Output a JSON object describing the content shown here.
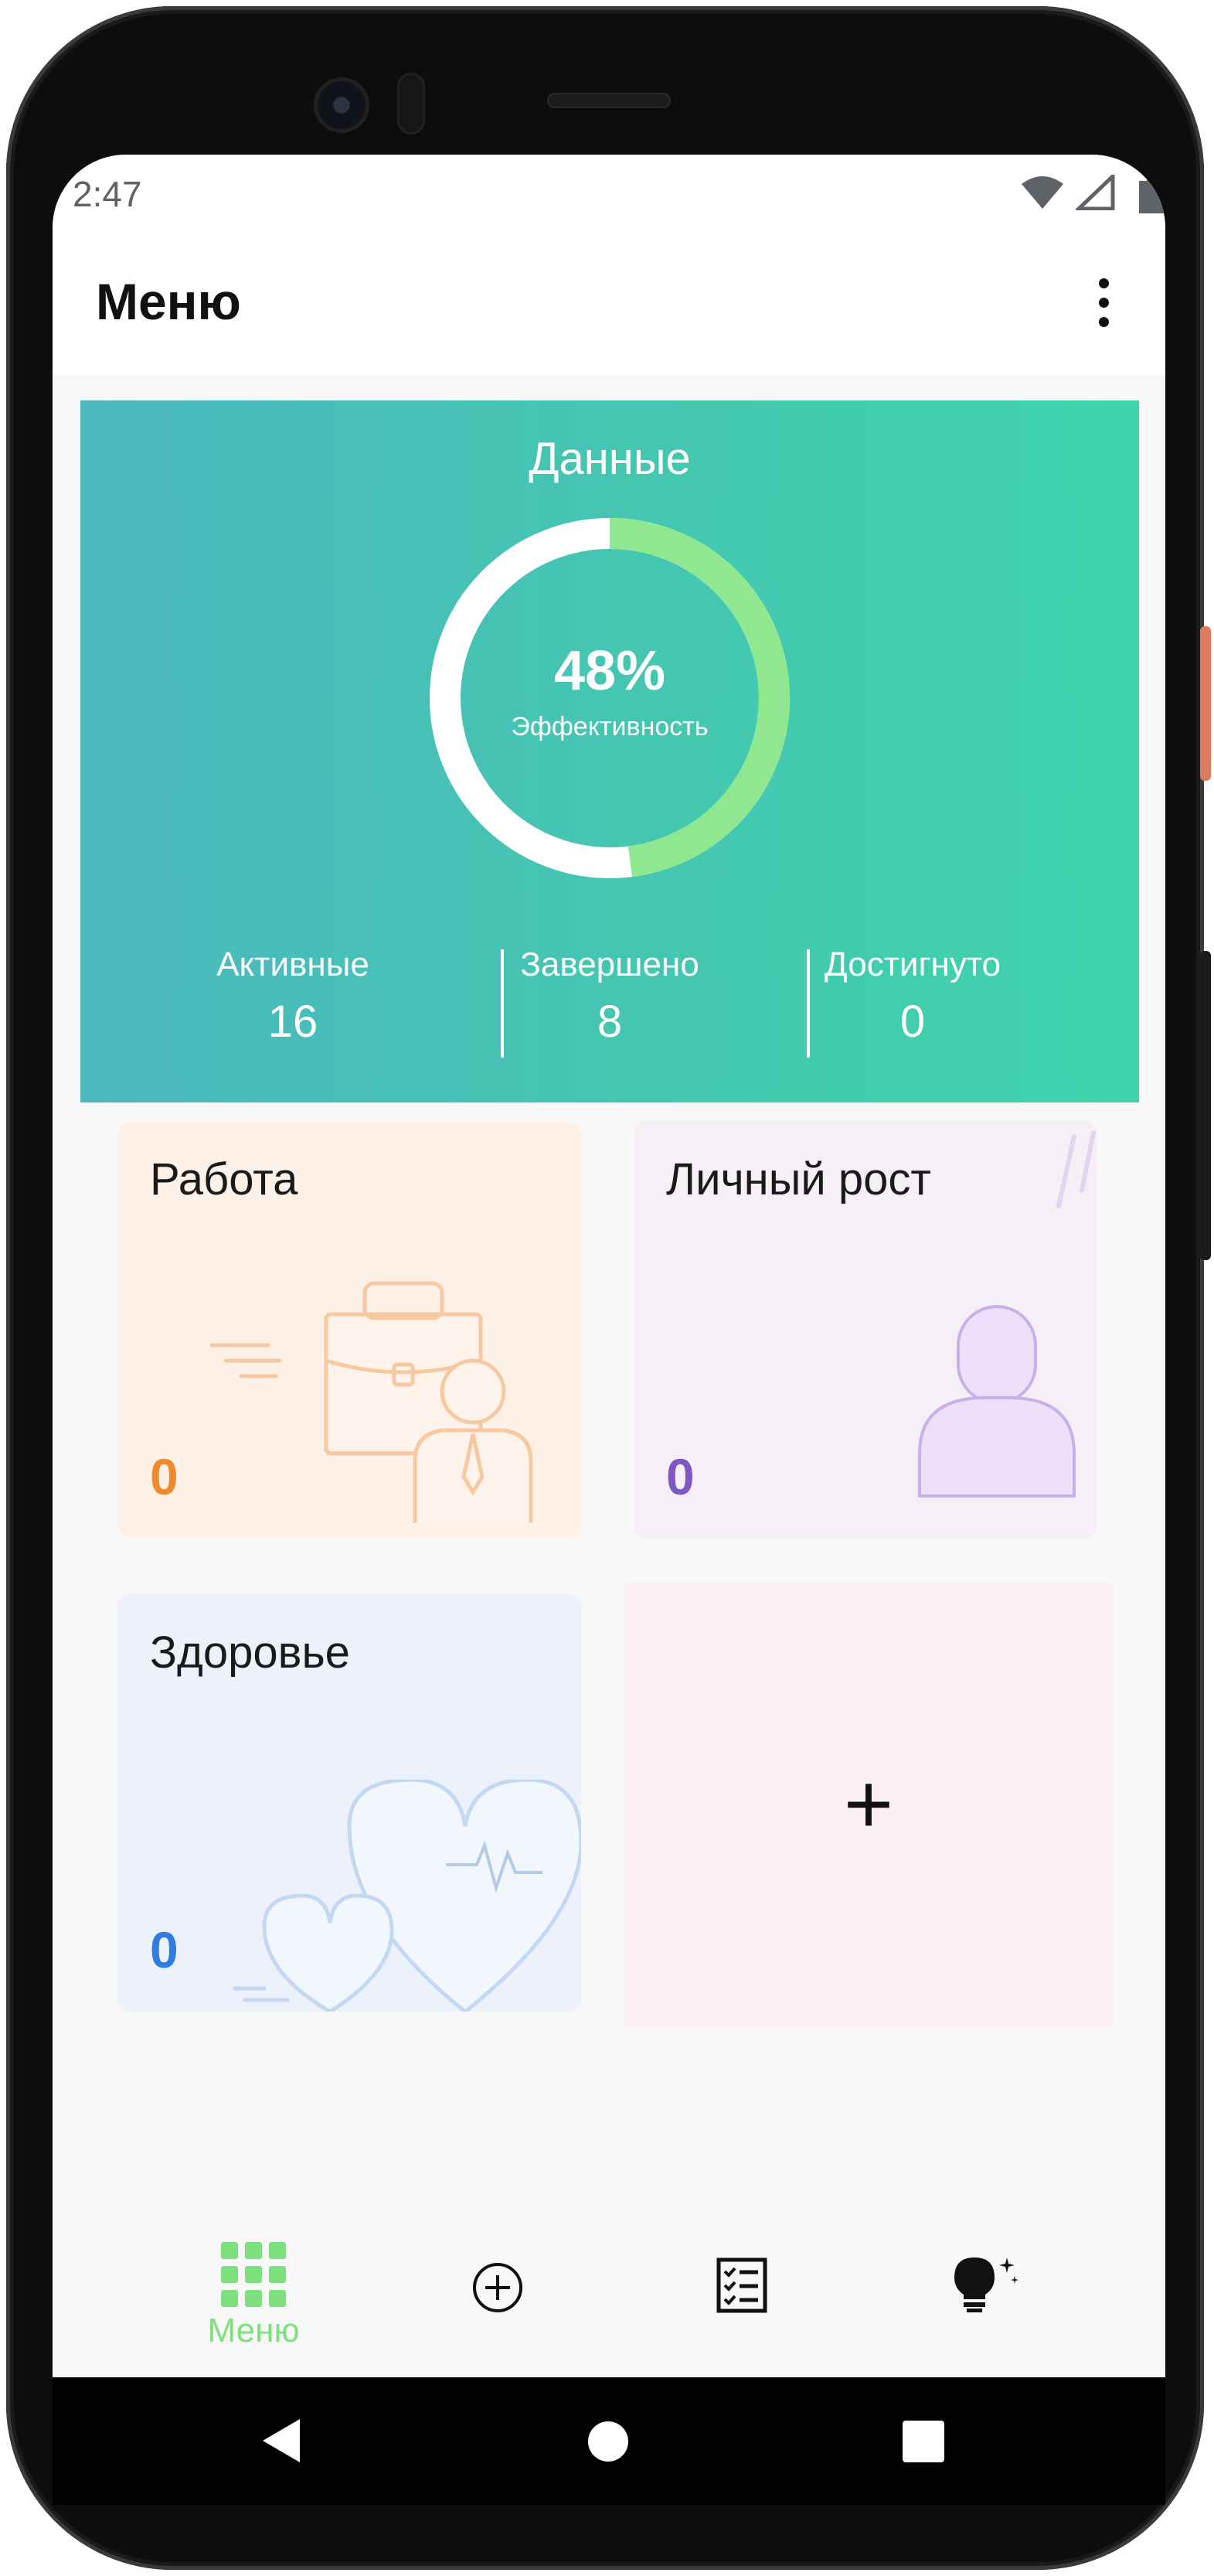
{
  "status_bar": {
    "time": "2:47",
    "icons": [
      "wifi-icon",
      "cell-signal-icon",
      "battery-icon"
    ]
  },
  "app_bar": {
    "title": "Меню",
    "more_icon": "more-vert-icon"
  },
  "summary": {
    "title": "Данные",
    "efficiency_percent": "48%",
    "efficiency_label": "Эффективность",
    "efficiency_value": 0.48,
    "stats": [
      {
        "label": "Активные",
        "value": "16"
      },
      {
        "label": "Завершено",
        "value": "8"
      },
      {
        "label": "Достигнуто",
        "value": "0"
      }
    ],
    "colors": {
      "gradient_start": "#4bb8c0",
      "gradient_end": "#3fd4ad",
      "progress": "#8fe88f",
      "track": "#ffffff"
    }
  },
  "categories": [
    {
      "title": "Работа",
      "count": "0",
      "color": "#f08a2a",
      "background": "#fdf1e8",
      "illustration": "briefcase-businessman-icon"
    },
    {
      "title": "Личный рост",
      "count": "0",
      "color": "#7e57c2",
      "background": "#f5f0f5",
      "illustration": "person-icon"
    },
    {
      "title": "Здоровье",
      "count": "0",
      "color": "#2f7de1",
      "background": "#ecf1fc",
      "illustration": "hearts-pulse-icon"
    }
  ],
  "add_card": {
    "label": "+",
    "background": "#fcf0f7"
  },
  "bottom_nav": {
    "items": [
      {
        "icon": "grid-icon",
        "label": "Меню",
        "active": true
      },
      {
        "icon": "add-circle-icon",
        "label": "",
        "active": false
      },
      {
        "icon": "checklist-icon",
        "label": "",
        "active": false
      },
      {
        "icon": "lightbulb-sparkle-icon",
        "label": "",
        "active": false
      }
    ],
    "active_color": "#7fe07f"
  }
}
